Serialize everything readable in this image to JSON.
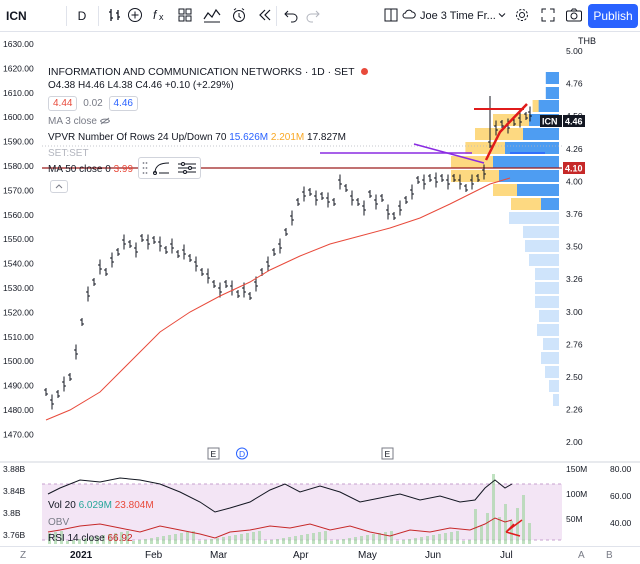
{
  "toolbar": {
    "symbol": "ICN",
    "interval": "D",
    "layout_name": "Joe 3 Time Fr...",
    "publish_label": "Publish"
  },
  "legend": {
    "title": "INFORMATION AND COMMUNICATION NETWORKS",
    "interval": "1D",
    "exchange": "SET",
    "ohlc": {
      "o_label": "O",
      "o": "4.38",
      "h_label": "H",
      "h": "4.46",
      "l_label": "L",
      "l": "4.38",
      "c_label": "C",
      "c": "4.46",
      "change": "+0.10 (+2.29%)"
    },
    "bid": "4.44",
    "spread": "0.02",
    "ask": "4.46",
    "ma3": "MA 3 close",
    "vpvr_label": "VPVR Number Of Rows 24 Up/Down 70",
    "vpvr_up": "15.626M",
    "vpvr_down": "2.201M",
    "vpvr_total": "17.827M",
    "setset": "SET:SET",
    "ma50_label": "MA 50 close 0",
    "ma50_value": "3.99"
  },
  "left_axis": [
    "1630.00",
    "1620.00",
    "1610.00",
    "1600.00",
    "1590.00",
    "1580.00",
    "1570.00",
    "1560.00",
    "1550.00",
    "1540.00",
    "1530.00",
    "1520.00",
    "1510.00",
    "1500.00",
    "1490.00",
    "1480.00",
    "1470.00"
  ],
  "right_axis": [
    "5.00",
    "4.76",
    "4.50",
    "4.26",
    "4.00",
    "3.76",
    "3.50",
    "3.26",
    "3.00",
    "2.76",
    "2.50",
    "2.26",
    "2.00"
  ],
  "right_axis_currency": "THB",
  "price_tags": {
    "symbol": "ICN",
    "last": "4.46",
    "line": "4.10"
  },
  "event_markers": [
    "E",
    "D",
    "E"
  ],
  "lower_pane": {
    "vol_label": "Vol 20",
    "vol_a": "6.029M",
    "vol_b": "23.804M",
    "obv_label": "OBV",
    "rsi_label": "RSI 14 close",
    "rsi_value": "66.92",
    "left_axis": [
      "3.88B",
      "3.84B",
      "3.8B",
      "3.76B"
    ],
    "right_vol_axis": [
      "150M",
      "100M",
      "50M"
    ],
    "right_rsi_axis": [
      "80.00",
      "60.00",
      "40.00"
    ]
  },
  "time_axis": {
    "labels": [
      "2021",
      "Feb",
      "Mar",
      "Apr",
      "May",
      "Jun",
      "Jul"
    ],
    "left_btn": "Z",
    "right_a": "A",
    "right_b": "B"
  },
  "colors": {
    "accent": "#2962ff",
    "ma_line": "#e84a3b",
    "horizontal_line": "#9c1c1c",
    "purple": "#8a2be2",
    "vp_up": "#2f8cf0",
    "vp_down": "#fbc02d",
    "rsi_bg": "#f3e5f5"
  }
}
